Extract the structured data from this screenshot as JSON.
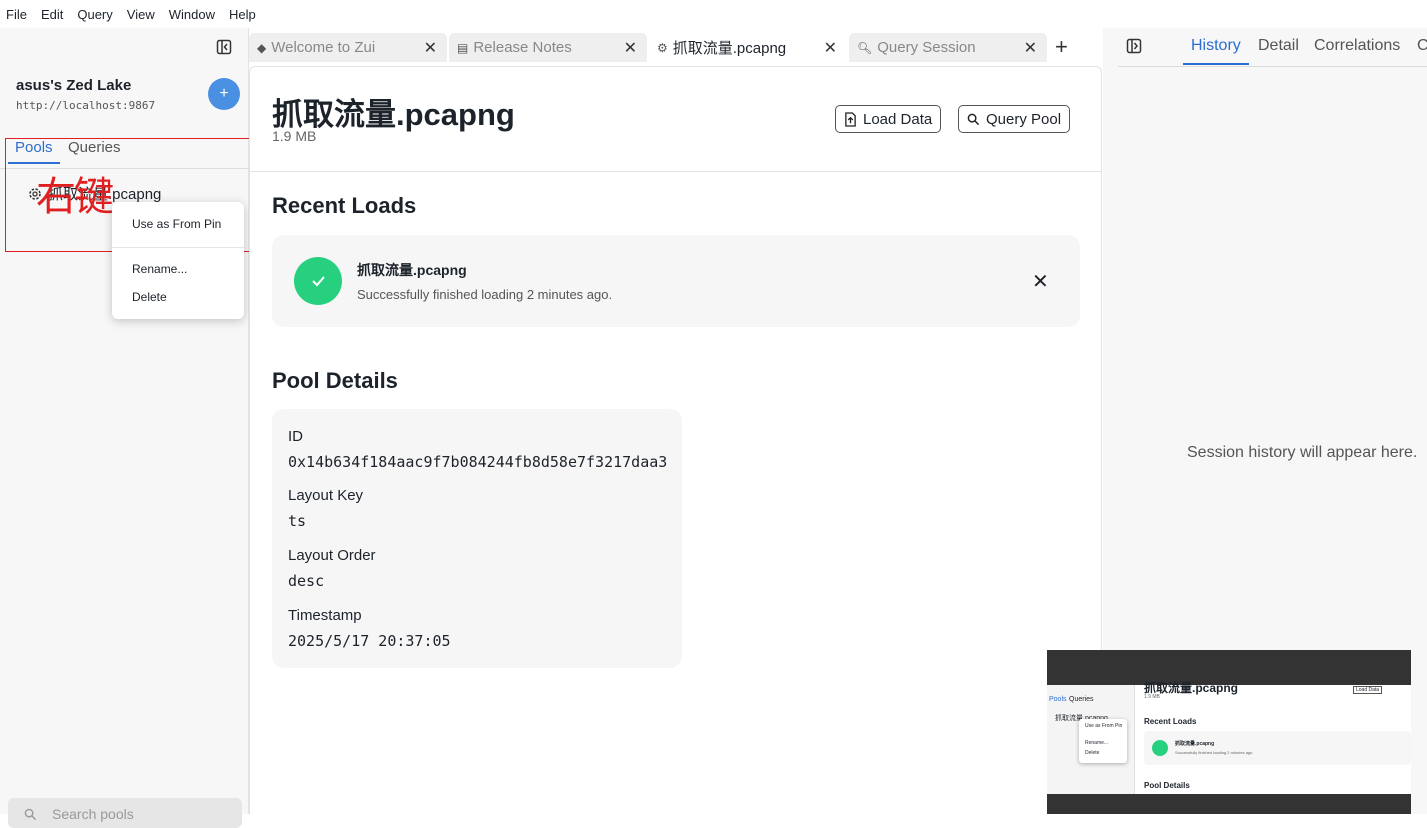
{
  "menu": [
    "File",
    "Edit",
    "Query",
    "View",
    "Window",
    "Help"
  ],
  "sidebar": {
    "lake_name": "asus's Zed Lake",
    "lake_url": "http://localhost:9867",
    "add_label": "+",
    "tabs": [
      "Pools",
      "Queries"
    ],
    "pool_item": "抓取流量.pcapng",
    "search_placeholder": "Search pools"
  },
  "annotation": {
    "text": "右键",
    "color": "#e02020"
  },
  "context_menu": {
    "items": [
      "Use as From Pin",
      "Rename...",
      "Delete"
    ]
  },
  "tabs": [
    {
      "label": "Welcome to Zui",
      "icon": "zui-icon",
      "active": false
    },
    {
      "label": "Release Notes",
      "icon": "document-icon",
      "active": false
    },
    {
      "label": "抓取流量.pcapng",
      "icon": "pool-icon",
      "active": true
    },
    {
      "label": "Query Session",
      "icon": "search-icon",
      "active": false
    }
  ],
  "main": {
    "title": "抓取流量.pcapng",
    "size": "1.9 MB",
    "load_data_label": "Load Data",
    "query_pool_label": "Query Pool",
    "recent_loads_heading": "Recent Loads",
    "load": {
      "name": "抓取流量.pcapng",
      "message": "Successfully finished loading 2 minutes ago."
    },
    "pool_details_heading": "Pool Details",
    "details": [
      {
        "label": "ID",
        "value": "0x14b634f184aac9f7b084244fb8d58e7f3217daa3"
      },
      {
        "label": "Layout Key",
        "value": "ts"
      },
      {
        "label": "Layout Order",
        "value": "desc"
      },
      {
        "label": "Timestamp",
        "value": "2025/5/17 20:37:05"
      }
    ]
  },
  "right_panel": {
    "tabs": [
      "History",
      "Detail",
      "Correlations",
      "C"
    ],
    "empty_message": "Session history will appear here."
  },
  "thumbnail": {
    "title": "抓取流量.pcapng",
    "size": "1.9 MB",
    "tabs": [
      "Pools",
      "Queries"
    ],
    "pool_item": "抓取流量.pcapng",
    "menu": [
      "Use as From Pin",
      "Rename...",
      "Delete"
    ],
    "load_data": "Load Data",
    "recent_loads": "Recent Loads",
    "load_name": "抓取流量.pcapng",
    "load_msg": "Successfully finished loading 2 minutes ago.",
    "pool_details": "Pool Details"
  },
  "colors": {
    "accent": "#2d6ecf",
    "success": "#27d07e",
    "add_button": "#4a90e2"
  }
}
